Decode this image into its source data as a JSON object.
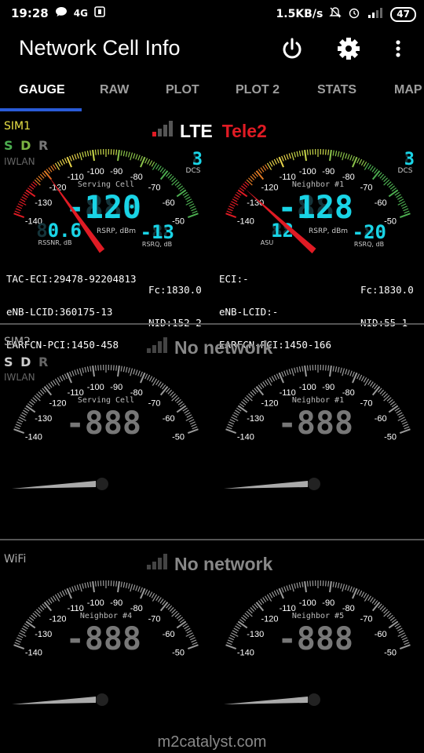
{
  "status": {
    "time": "19:28",
    "network_small": "4G",
    "speed": "1.5KB/s",
    "battery": "47",
    "signal_small": "4G"
  },
  "app": {
    "title": "Network Cell Info"
  },
  "tabs": [
    "GAUGE",
    "RAW",
    "PLOT",
    "PLOT 2",
    "STATS",
    "MAP"
  ],
  "sim1": {
    "label": "SIM1",
    "s": "S",
    "d": "D",
    "r": "R",
    "iwlan": "IWLAN",
    "tech": "LTE",
    "operator": "Tele2",
    "operator_color": "#e01b24",
    "gauges": [
      {
        "title": "Serving Cell",
        "main": "-120",
        "main_ghost": "-888",
        "top_right": "3",
        "top_right_ghost": "8",
        "top_right_label": "DCS",
        "main_label": "RSRP, dBm",
        "bl": "0.6",
        "bl_ghost": "88.8",
        "bl_label": "RSSNR, dB",
        "br": "-13",
        "br_ghost": "-88",
        "br_label": "RSRQ, dB",
        "value": -120,
        "active": true
      },
      {
        "title": "Neighbor #1",
        "main": "-128",
        "main_ghost": "-888",
        "top_right": "3",
        "top_right_ghost": "8",
        "top_right_label": "DCS",
        "main_label": "RSRP, dBm",
        "bl": "12",
        "bl_ghost": "88",
        "bl_label": "ASU",
        "br": "-20",
        "br_ghost": "-88",
        "br_label": "RSRQ, dB",
        "value": -128,
        "active": true
      }
    ],
    "info_left": [
      "TAC-ECI:29478-92204813",
      "eNB-LCID:360175-13",
      "EARFCN-PCI:1450-458"
    ],
    "info_left_r": [
      "",
      "Fc:1830.0",
      "NID:152-2"
    ],
    "info_right": [
      "ECI:-",
      "eNB-LCID:-",
      "EARFCN-PCI:1450-166"
    ],
    "info_right_r": [
      "",
      "Fc:1830.0",
      "NID:55-1"
    ]
  },
  "sim2": {
    "label": "SIM2",
    "s": "S",
    "d": "D",
    "r": "R",
    "iwlan": "IWLAN",
    "status": "No network",
    "gauges": [
      {
        "title": "Serving Cell",
        "main": "-888",
        "active": false
      },
      {
        "title": "Neighbor #1",
        "main": "-888",
        "active": false
      }
    ]
  },
  "wifi": {
    "label": "WiFi",
    "status": "No network",
    "gauges": [
      {
        "title": "Neighbor #4",
        "main": "-888",
        "active": false
      },
      {
        "title": "Neighbor #5",
        "main": "-888",
        "active": false
      }
    ]
  },
  "ticks": [
    "-140",
    "-130",
    "-120",
    "-110",
    "-100",
    "-90",
    "-80",
    "-70",
    "-60",
    "-50"
  ],
  "footer": "m2catalyst.com",
  "colors": {
    "accent": "#2a5bd7",
    "lcd": "#19d4e6",
    "needle": "#e01b24",
    "s_green": "#4caf50",
    "d_green": "#7cb342",
    "r_grey": "#777"
  }
}
